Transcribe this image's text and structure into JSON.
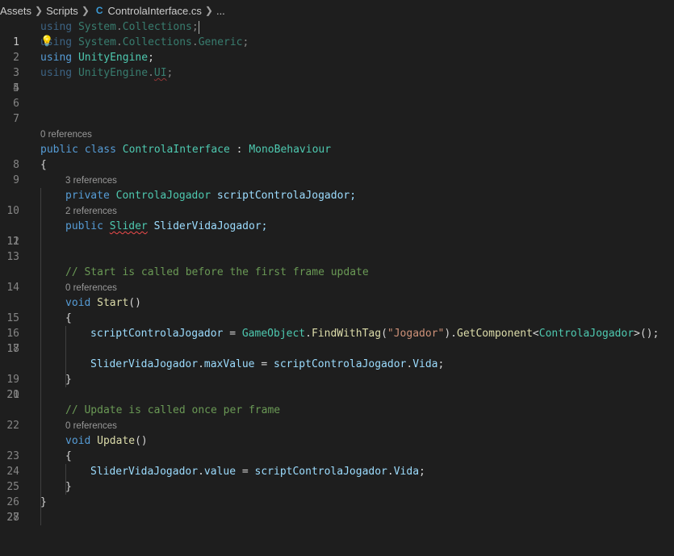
{
  "breadcrumb": {
    "items": [
      "Assets",
      "Scripts",
      "ControlaInterface.cs",
      "..."
    ],
    "file_icon": "C"
  },
  "lens": {
    "class_refs": "0 references",
    "field1_refs": "3 references",
    "field2_refs": "2 references",
    "start_refs": "0 references",
    "update_refs": "0 references"
  },
  "code": {
    "l1": [
      "using",
      "System",
      ".",
      "Collections",
      ";"
    ],
    "l2": [
      "using",
      "System",
      ".",
      "Collections",
      ".",
      "Generic",
      ";"
    ],
    "l3": [
      "using",
      "UnityEngine",
      ";"
    ],
    "l4": [
      "using",
      "UnityEngine",
      ".",
      "UI",
      ";"
    ],
    "l8": [
      "public",
      "class",
      "ControlaInterface",
      ":",
      "MonoBehaviour"
    ],
    "l9": "{",
    "l10": [
      "private",
      "ControlaJogador",
      "scriptControlaJogador;"
    ],
    "l11": [
      "public",
      "Slider",
      "SliderVidaJogador;"
    ],
    "l14": "// Start is called before the first frame update",
    "l15": [
      "void",
      "Start",
      "()"
    ],
    "l16": "{",
    "l17": [
      "scriptControlaJogador",
      " = ",
      "GameObject",
      ".",
      "FindWithTag",
      "(",
      "\"Jogador\"",
      ").",
      "GetComponent",
      "<",
      "ControlaJogador",
      ">();"
    ],
    "l19": [
      "SliderVidaJogador",
      ".",
      "maxValue",
      " = ",
      "scriptControlaJogador",
      ".",
      "Vida",
      ";"
    ],
    "l20": "}",
    "l22": "// Update is called once per frame",
    "l23": [
      "void",
      "Update",
      "()"
    ],
    "l24": "{",
    "l25": [
      "SliderVidaJogador",
      ".",
      "value",
      " = ",
      "scriptControlaJogador",
      ".",
      "Vida",
      ";"
    ],
    "l26": "}",
    "l27": "}"
  },
  "line_numbers": [
    "1",
    "2",
    "3",
    "4",
    "5",
    "6",
    "7",
    "8",
    "9",
    "10",
    "11",
    "12",
    "13",
    "14",
    "15",
    "16",
    "17",
    "18",
    "19",
    "20",
    "21",
    "22",
    "23",
    "24",
    "25",
    "26",
    "27",
    "28"
  ],
  "colors": {
    "background": "#1e1e1e",
    "keyword": "#569cd6",
    "type": "#4ec9b0",
    "function": "#dcdcaa",
    "variable": "#9cdcfe",
    "string": "#ce9178",
    "comment": "#6a9955"
  },
  "icons": [
    "csharp-file-icon",
    "lightbulb-icon",
    "chevron-right-icon"
  ]
}
